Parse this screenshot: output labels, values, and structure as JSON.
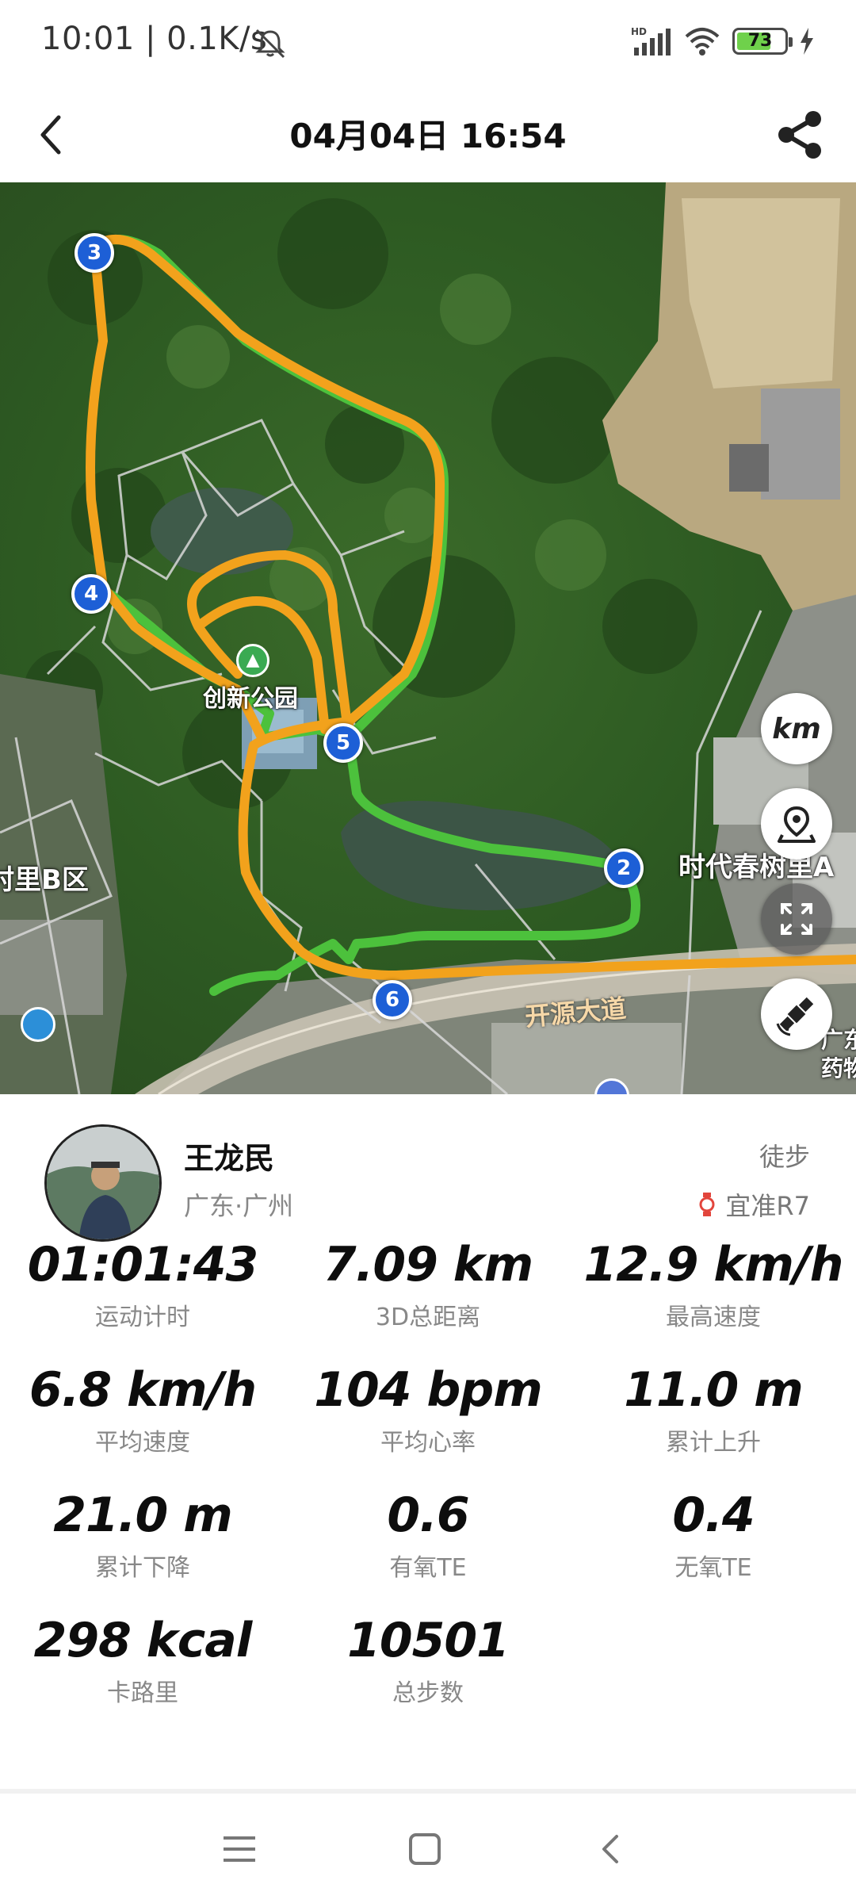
{
  "status_bar": {
    "time": "10:01 | 0.1K/s",
    "battery": "73"
  },
  "header": {
    "title": "04月04日 16:54"
  },
  "map": {
    "park_label": "创新公园",
    "area_left_label": "村里B区",
    "area_right_label": "时代春树里A",
    "road_label": "开源大道",
    "edge_label_1": "广东",
    "edge_label_2": "药物",
    "markers": [
      "2",
      "3",
      "4",
      "5",
      "6"
    ],
    "unit_button": "km"
  },
  "profile": {
    "name": "王龙民",
    "location": "广东·广州",
    "sport": "徒步",
    "device": "宜准R7"
  },
  "stats": [
    {
      "value": "01:01:43",
      "label": "运动计时"
    },
    {
      "value": "7.09 km",
      "label": "3D总距离"
    },
    {
      "value": "12.9 km/h",
      "label": "最高速度"
    },
    {
      "value": "6.8 km/h",
      "label": "平均速度"
    },
    {
      "value": "104 bpm",
      "label": "平均心率"
    },
    {
      "value": "11.0 m",
      "label": "累计上升"
    },
    {
      "value": "21.0 m",
      "label": "累计下降"
    },
    {
      "value": "0.6",
      "label": "有氧TE"
    },
    {
      "value": "0.4",
      "label": "无氧TE"
    },
    {
      "value": "298 kcal",
      "label": "卡路里"
    },
    {
      "value": "10501",
      "label": "总步数"
    }
  ]
}
